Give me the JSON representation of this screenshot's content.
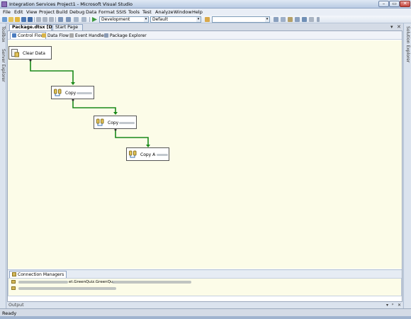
{
  "window": {
    "title": "Integration Services Project1 - Microsoft Visual Studio",
    "controls": {
      "minimize": "–",
      "maximize": "▭",
      "close": "✕"
    }
  },
  "menu": [
    "File",
    "Edit",
    "View",
    "Project",
    "Build",
    "Debug",
    "Data",
    "Format",
    "SSIS",
    "Tools",
    "Test",
    "Analyze",
    "Window",
    "Help"
  ],
  "toolbar": {
    "configuration": "Development",
    "platform": "Default",
    "icons": [
      "new-project-icon",
      "add-item-icon",
      "open-icon",
      "save-icon",
      "save-all-icon",
      "cut-icon",
      "copy-icon",
      "paste-icon",
      "undo-icon",
      "redo-icon",
      "navigate-back-icon",
      "navigate-forward-icon",
      "start-debug-icon",
      "find-icon",
      "solution-explorer-icon",
      "properties-icon",
      "toolbox-icon"
    ]
  },
  "side_panels": {
    "left": [
      "Toolbox",
      "Server Explorer"
    ],
    "right": [
      "Solution Explorer"
    ]
  },
  "document_tabs": [
    {
      "label": "Package.dtsx [Design]*",
      "active": true
    },
    {
      "label": "Start Page",
      "active": false
    }
  ],
  "designer_tabs": [
    {
      "label": "Control Flow",
      "active": true,
      "icon": "control-flow-icon"
    },
    {
      "label": "Data Flow",
      "active": false,
      "icon": "data-flow-icon"
    },
    {
      "label": "Event Handlers",
      "active": false,
      "icon": "event-handlers-icon"
    },
    {
      "label": "Package Explorer",
      "active": false,
      "icon": "package-explorer-icon"
    }
  ],
  "tasks": [
    {
      "label": "Clear Data",
      "icon": "execute-sql-task-icon"
    },
    {
      "label": "Copy",
      "icon": "data-flow-task-icon",
      "redacted": true
    },
    {
      "label": "Copy",
      "icon": "data-flow-task-icon",
      "redacted": true
    },
    {
      "label": "Copy A",
      "icon": "data-flow-task-icon",
      "redacted": true
    }
  ],
  "connection_managers": {
    "tab_label": "Connection Managers",
    "items": [
      {
        "visible_text": "et.GreenQuiz.GreenQu.",
        "redacted": true
      },
      {
        "visible_text": "",
        "redacted": true
      }
    ]
  },
  "output": {
    "label": "Output",
    "controls": [
      "▾",
      "ᵖ",
      "✕"
    ]
  },
  "status": {
    "text": "Ready"
  },
  "colors": {
    "precedence_success": "#1a8a1a",
    "canvas_bg": "#fcfce8",
    "titlebar_bg": "#c9d8ec"
  }
}
